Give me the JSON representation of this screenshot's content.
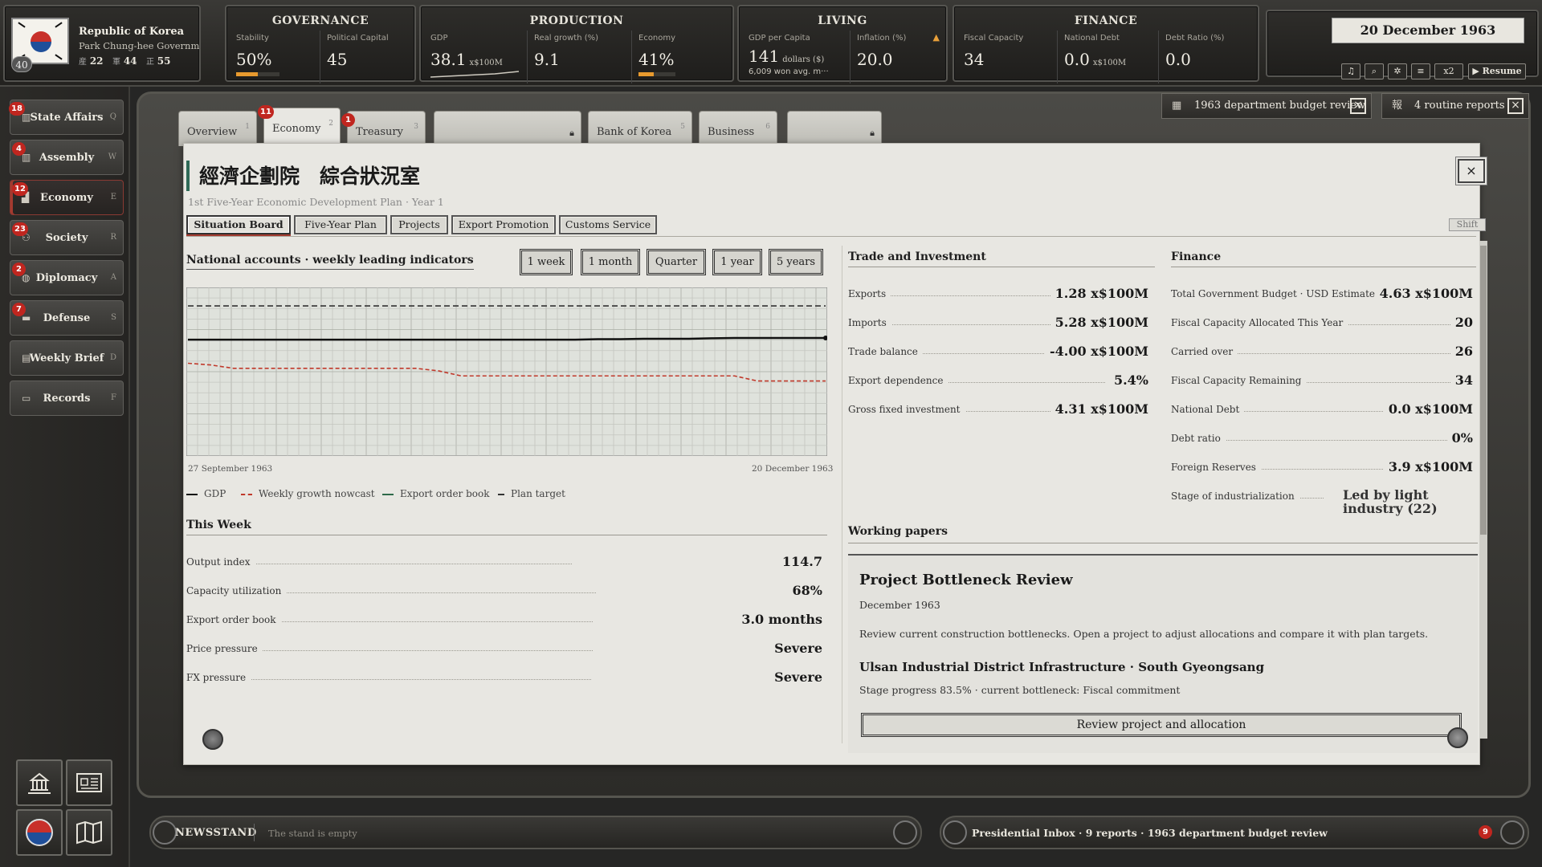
{
  "country": {
    "name": "Republic of Korea",
    "government": "Park Chung-hee Government",
    "badge_number": "40",
    "stats": [
      {
        "glyph": "産",
        "value": "22"
      },
      {
        "glyph": "軍",
        "value": "44"
      },
      {
        "glyph": "正",
        "value": "55"
      }
    ]
  },
  "governance": {
    "title": "GOVERNANCE",
    "stability_label": "Stability",
    "stability_value": "50%",
    "stability_level": 0.5,
    "capital_label": "Political Capital",
    "capital_value": "45"
  },
  "production": {
    "title": "PRODUCTION",
    "gdp_label": "GDP",
    "gdp_value": "38.1",
    "gdp_unit": "x$100M",
    "growth_label": "Real growth (%)",
    "growth_value": "9.1",
    "economy_label": "Economy",
    "economy_value": "41%",
    "economy_level": 0.41
  },
  "living": {
    "title": "LIVING",
    "gdppc_label": "GDP per Capita",
    "gdppc_value": "141",
    "gdppc_unit": "dollars ($)",
    "gdppc_sub": "6,009 won avg. m···",
    "inflation_label": "Inflation (%)",
    "inflation_value": "20.0"
  },
  "finance_top": {
    "title": "FINANCE",
    "capacity_label": "Fiscal Capacity",
    "capacity_value": "34",
    "debt_label": "National Debt",
    "debt_value": "0.0",
    "debt_unit": "x$100M",
    "ratio_label": "Debt Ratio (%)",
    "ratio_value": "0.0"
  },
  "date": "20 December 1963",
  "controls": {
    "speed": "x2",
    "resume": "▶ Resume"
  },
  "notices": [
    {
      "text": "1963 department budget review"
    },
    {
      "text": "4 routine reports"
    }
  ],
  "nav": [
    {
      "label": "State Affairs",
      "key": "Q",
      "badge": "18"
    },
    {
      "label": "Assembly",
      "key": "W",
      "badge": "4"
    },
    {
      "label": "Economy",
      "key": "E",
      "badge": "12"
    },
    {
      "label": "Society",
      "key": "R",
      "badge": "23"
    },
    {
      "label": "Diplomacy",
      "key": "A",
      "badge": "2"
    },
    {
      "label": "Defense",
      "key": "S",
      "badge": "7"
    },
    {
      "label": "Weekly Brief",
      "key": "D",
      "badge": ""
    },
    {
      "label": "Records",
      "key": "F",
      "badge": ""
    }
  ],
  "tabs": [
    {
      "label": "Overview",
      "num": "1"
    },
    {
      "label": "Economy",
      "num": "2",
      "badge": "11"
    },
    {
      "label": "Treasury",
      "num": "3",
      "badge": "1"
    },
    {
      "label": "",
      "num": ""
    },
    {
      "label": "Bank of Korea",
      "num": "5"
    },
    {
      "label": "Business",
      "num": "6"
    },
    {
      "label": "",
      "num": ""
    }
  ],
  "page": {
    "title": "經濟企劃院　綜合狀況室",
    "subtitle": "1st Five-Year Economic Development Plan · Year 1",
    "shift_label": "Shift"
  },
  "subtabs": [
    "Situation Board",
    "Five-Year Plan",
    "Projects",
    "Export Promotion",
    "Customs Service"
  ],
  "chart_section": {
    "title": "National accounts · weekly leading indicators",
    "ranges": [
      "1 week",
      "1 month",
      "Quarter",
      "1 year",
      "5 years"
    ]
  },
  "chart_data": {
    "type": "line",
    "x_start": "27 September 1963",
    "x_end": "20 December 1963",
    "ylim": [
      0,
      100
    ],
    "grid": true,
    "legend_position": "bottom",
    "series": [
      {
        "name": "GDP",
        "color": "#111111",
        "style": "solid",
        "values": [
          69,
          69,
          69,
          69,
          69,
          69,
          69,
          69,
          69,
          69,
          69,
          69,
          69,
          69,
          69,
          69,
          69,
          69,
          69.3,
          69.3,
          69.5,
          69.5,
          69.5,
          69.8,
          70,
          70,
          70,
          70,
          70
        ]
      },
      {
        "name": "Weekly growth nowcast",
        "color": "#c0392b",
        "style": "dashed",
        "values": [
          55,
          54,
          52,
          52,
          52,
          52,
          52,
          52,
          52,
          52,
          52,
          50.5,
          47.5,
          47.5,
          47.5,
          47.5,
          47.5,
          47.5,
          47.5,
          47.5,
          47.5,
          47.5,
          47.5,
          47.5,
          47.5,
          44.5,
          44.5,
          44.5,
          44.5
        ]
      },
      {
        "name": "Export order book",
        "color": "#2e6a4a",
        "style": "solid",
        "values": []
      },
      {
        "name": "Plan target",
        "color": "#333333",
        "style": "dashed",
        "values": [
          89,
          89,
          89,
          89,
          89,
          89,
          89,
          89,
          89,
          89,
          89,
          89,
          89,
          89,
          89,
          89,
          89,
          89,
          89,
          89,
          89,
          89,
          89,
          89,
          89,
          89,
          89,
          89,
          89
        ]
      }
    ]
  },
  "this_week": {
    "title": "This Week",
    "rows": [
      {
        "label": "Output index",
        "value": "114.7"
      },
      {
        "label": "Capacity utilization",
        "value": "68%"
      },
      {
        "label": "Export order book",
        "value": "3.0 months"
      },
      {
        "label": "Price pressure",
        "value": "Severe"
      },
      {
        "label": "FX pressure",
        "value": "Severe"
      }
    ]
  },
  "trade": {
    "title": "Trade and Investment",
    "rows": [
      {
        "label": "Exports",
        "value": "1.28 x$100M"
      },
      {
        "label": "Imports",
        "value": "5.28 x$100M"
      },
      {
        "label": "Trade balance",
        "value": "-4.00 x$100M"
      },
      {
        "label": "Export dependence",
        "value": "5.4%"
      },
      {
        "label": "Gross fixed investment",
        "value": "4.31 x$100M"
      }
    ]
  },
  "finance": {
    "title": "Finance",
    "rows": [
      {
        "label": "Total Government Budget · USD Estimate",
        "value": "4.63 x$100M"
      },
      {
        "label": "Fiscal Capacity Allocated This Year",
        "value": "20"
      },
      {
        "label": "Carried over",
        "value": "26"
      },
      {
        "label": "Fiscal Capacity Remaining",
        "value": "34"
      },
      {
        "label": "National Debt",
        "value": "0.0 x$100M"
      },
      {
        "label": "Debt ratio",
        "value": "0%"
      },
      {
        "label": "Foreign Reserves",
        "value": "3.9 x$100M"
      }
    ],
    "stage_label": "Stage of industrialization",
    "stage_value": "Led by light industry (22)"
  },
  "working_papers": {
    "title": "Working papers",
    "doc_title": "Project Bottleneck Review",
    "doc_date": "December 1963",
    "doc_body": "Review current construction bottlenecks. Open a project to adjust allocations and compare it with plan targets.",
    "project_title": "Ulsan Industrial District Infrastructure · South Gyeongsang",
    "project_status": "Stage progress 83.5% · current bottleneck: Fiscal commitment",
    "action_label": "Review project and allocation"
  },
  "bottom": {
    "newsstand_label": "NEWSSTAND",
    "newsstand_text": "The stand is empty",
    "inbox_text": "Presidential Inbox · 9 reports · 1963 department budget review",
    "inbox_badge": "9"
  }
}
